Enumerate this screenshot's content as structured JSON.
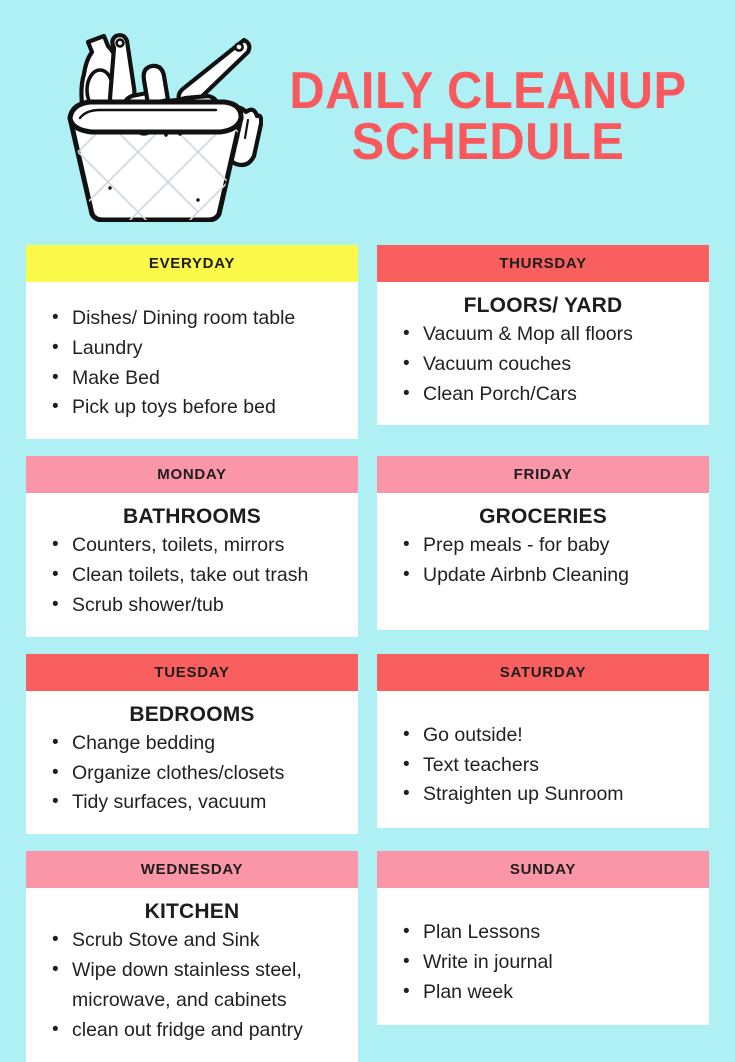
{
  "poster": {
    "title_line1": "DAILY CLEANUP",
    "title_line2": "SCHEDULE",
    "illustration": "cleaning-bucket-illustration",
    "colors": {
      "background": "#aff0f5",
      "title": "#f9595c",
      "header_yellow": "#fbf94a",
      "header_red": "#fa5f5f",
      "header_pink": "#fb95a8",
      "card_background": "#ffffff",
      "text": "#231f20"
    }
  },
  "cards": [
    {
      "day": "EVERYDAY",
      "header_color": "#fbf94a",
      "subtitle": "",
      "items": [
        "Dishes/ Dining room table",
        "Laundry",
        "Make Bed",
        "Pick up toys before bed"
      ]
    },
    {
      "day": "THURSDAY",
      "header_color": "#fa5f5f",
      "subtitle": "FLOORS/ YARD",
      "items": [
        "Vacuum & Mop all floors",
        "Vacuum couches",
        "Clean Porch/Cars"
      ]
    },
    {
      "day": "MONDAY",
      "header_color": "#fb95a8",
      "subtitle": "BATHROOMS",
      "items": [
        "Counters, toilets, mirrors",
        "Clean toilets, take out trash",
        "Scrub shower/tub"
      ]
    },
    {
      "day": "FRIDAY",
      "header_color": "#fb95a8",
      "subtitle": "GROCERIES",
      "items": [
        "Prep meals - for baby",
        "Update Airbnb Cleaning"
      ]
    },
    {
      "day": "TUESDAY",
      "header_color": "#fa5f5f",
      "subtitle": "BEDROOMS",
      "items": [
        "Change bedding",
        "Organize clothes/closets",
        "Tidy surfaces, vacuum"
      ]
    },
    {
      "day": "SATURDAY",
      "header_color": "#fa5f5f",
      "subtitle": "",
      "items": [
        "Go outside!",
        "Text teachers",
        "Straighten up Sunroom"
      ]
    },
    {
      "day": "WEDNESDAY",
      "header_color": "#fb95a8",
      "subtitle": "KITCHEN",
      "items": [
        "Scrub Stove and Sink",
        "Wipe down stainless steel, microwave, and cabinets",
        "clean out fridge and pantry"
      ]
    },
    {
      "day": "SUNDAY",
      "header_color": "#fb95a8",
      "subtitle": "",
      "items": [
        "Plan Lessons",
        "Write in journal",
        "Plan week"
      ]
    }
  ]
}
